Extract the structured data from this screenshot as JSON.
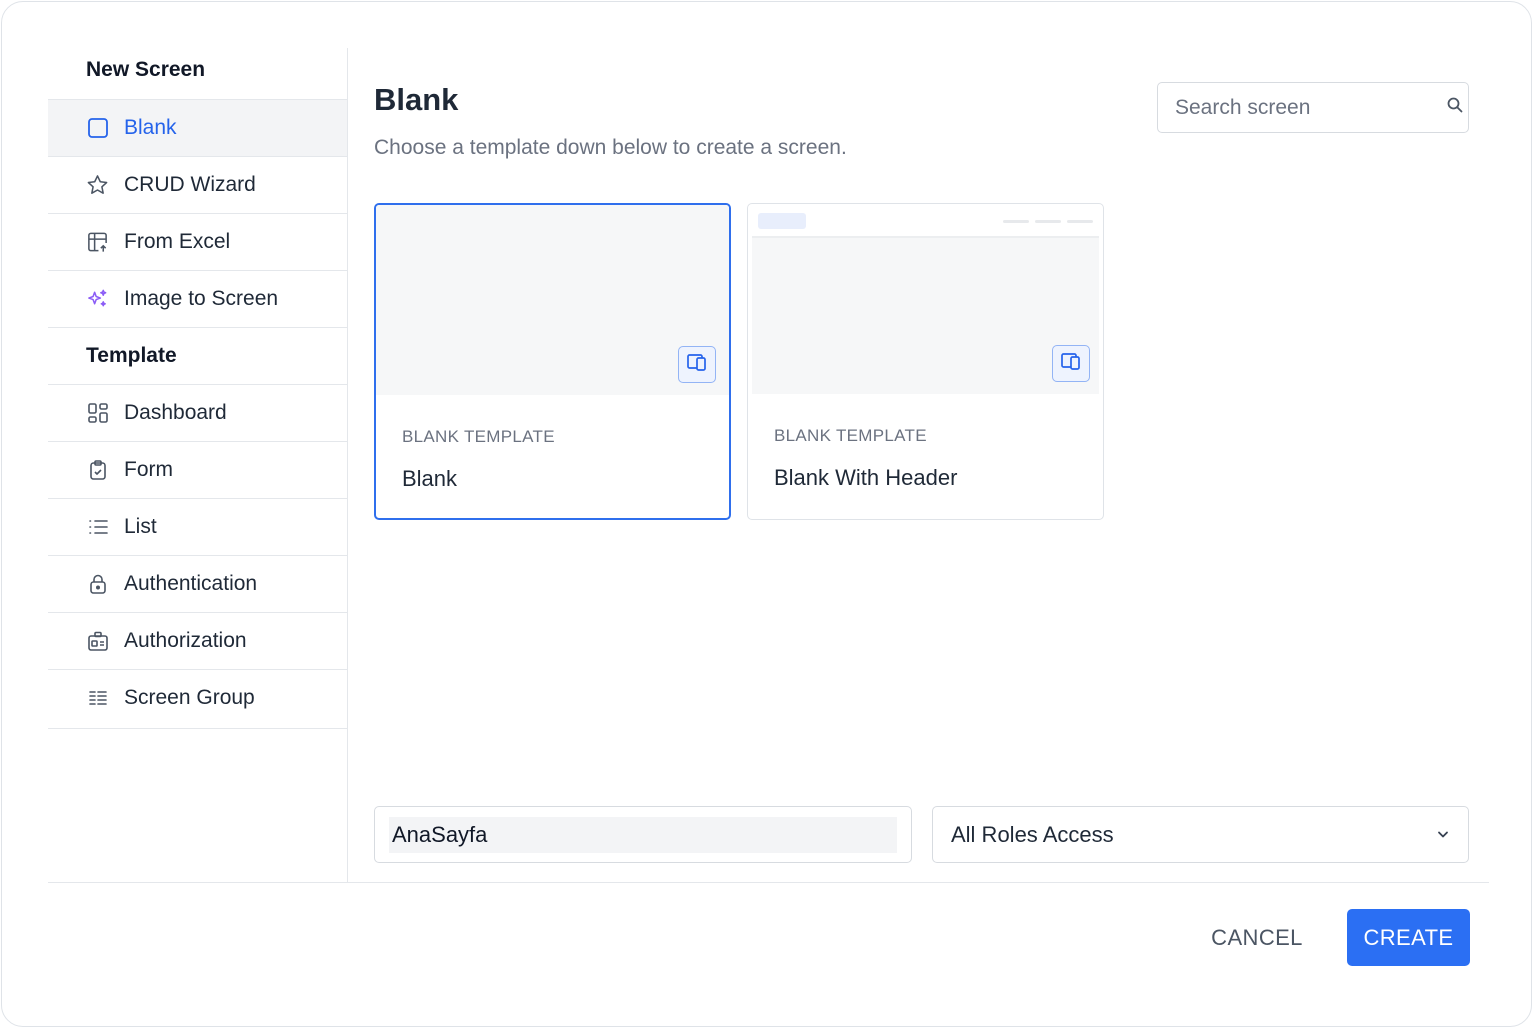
{
  "sidebar": {
    "new_screen_title": "New Screen",
    "new_screen_items": [
      {
        "label": "Blank",
        "icon": "square-icon",
        "active": true
      },
      {
        "label": "CRUD Wizard",
        "icon": "star-icon"
      },
      {
        "label": "From Excel",
        "icon": "table-upload-icon"
      },
      {
        "label": "Image to Screen",
        "icon": "sparkles-icon"
      }
    ],
    "template_title": "Template",
    "template_items": [
      {
        "label": "Dashboard",
        "icon": "dashboard-icon"
      },
      {
        "label": "Form",
        "icon": "clipboard-check-icon"
      },
      {
        "label": "List",
        "icon": "list-icon"
      },
      {
        "label": "Authentication",
        "icon": "lock-icon"
      },
      {
        "label": "Authorization",
        "icon": "id-badge-icon"
      },
      {
        "label": "Screen Group",
        "icon": "grouped-list-icon"
      }
    ]
  },
  "main": {
    "title": "Blank",
    "subtitle": "Choose a template down below to create a screen.",
    "search": {
      "placeholder": "Search screen",
      "value": ""
    },
    "cards": [
      {
        "kicker": "BLANK TEMPLATE",
        "name": "Blank",
        "selected": true
      },
      {
        "kicker": "BLANK TEMPLATE",
        "name": "Blank With Header",
        "selected": false
      }
    ]
  },
  "form": {
    "screen_name": "AnaSayfa",
    "role_access": "All Roles Access"
  },
  "footer": {
    "cancel_label": "CANCEL",
    "create_label": "CREATE"
  },
  "colors": {
    "accent": "#2b6ff3",
    "selected_border": "#2f6fed",
    "sparkle": "#8b5cf6"
  }
}
